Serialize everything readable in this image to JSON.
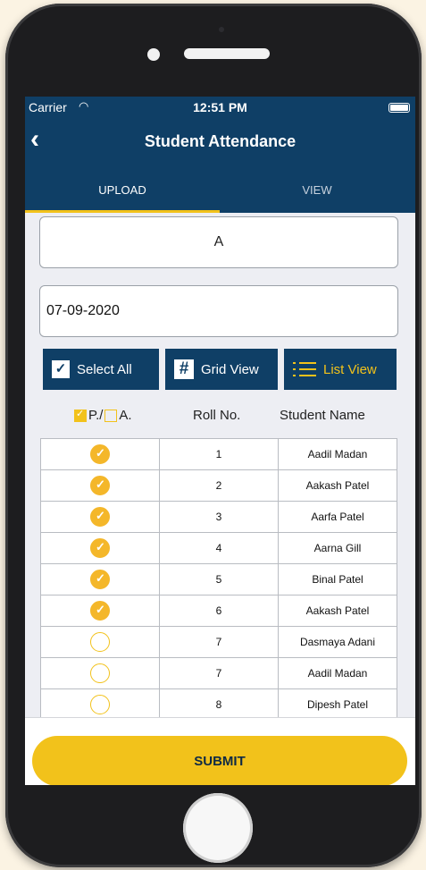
{
  "status_bar": {
    "carrier": "Carrier",
    "time": "12:51 PM"
  },
  "header": {
    "title": "Student Attendance",
    "back_icon": "chevron-left-icon"
  },
  "tabs": [
    {
      "label": "UPLOAD",
      "active": true
    },
    {
      "label": "VIEW",
      "active": false
    }
  ],
  "section_value": "A",
  "date_value": "07-09-2020",
  "actions": {
    "select_all": "Select All",
    "grid_view": "Grid View",
    "list_view": "List View"
  },
  "table_header": {
    "present": "P./",
    "absent": "A.",
    "roll_no": "Roll No.",
    "student_name": "Student Name"
  },
  "students": [
    {
      "present": true,
      "roll": "1",
      "name": "Aadil Madan"
    },
    {
      "present": true,
      "roll": "2",
      "name": "Aakash Patel"
    },
    {
      "present": true,
      "roll": "3",
      "name": "Aarfa Patel"
    },
    {
      "present": true,
      "roll": "4",
      "name": "Aarna Gill"
    },
    {
      "present": true,
      "roll": "5",
      "name": "Binal Patel"
    },
    {
      "present": true,
      "roll": "6",
      "name": "Aakash Patel"
    },
    {
      "present": false,
      "roll": "7",
      "name": "Dasmaya Adani"
    },
    {
      "present": false,
      "roll": "7",
      "name": "Aadil Madan"
    },
    {
      "present": false,
      "roll": "8",
      "name": "Dipesh  Patel"
    }
  ],
  "submit_label": "SUBMIT",
  "colors": {
    "primary": "#0f3f66",
    "accent": "#f2c21b",
    "check": "#f4b72a"
  }
}
